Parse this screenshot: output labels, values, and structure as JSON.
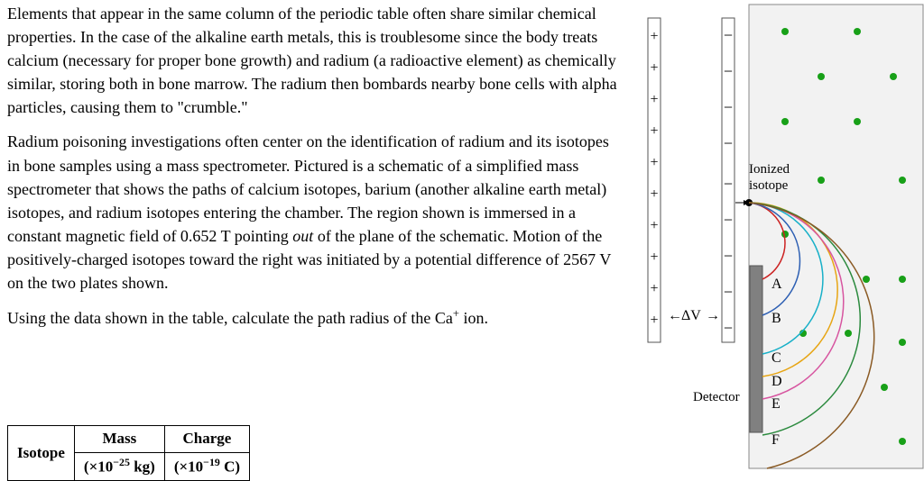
{
  "para1": "Elements that appear in the same column of the periodic table often share similar chemical properties. In the case of the alkaline earth metals, this is troublesome since the body treats calcium (necessary for proper bone growth) and radium (a radioactive element) as chemically similar, storing both in bone marrow. The radium then bombards nearby bone cells with alpha particles, causing them to \"crumble.\"",
  "para2": "Radium poisoning investigations often center on the identification of radium and its isotopes in bone samples using a mass spectrometer. Pictured is a schematic of a simplified mass spectrometer that shows the paths of calcium isotopes, barium (another alkaline earth metal) isotopes, and radium isotopes entering the chamber. The region shown is immersed in a constant magnetic field of 0.652 T pointing ",
  "para2_italic": "out",
  "para2_b": " of the plane of the schematic. Motion of the positively-charged isotopes toward the right was initiated by a potential difference of 2567 V on the two plates shown.",
  "para3_a": "Using the data shown in the table, calculate the path radius of the Ca",
  "para3_b": " ion.",
  "table": {
    "h_isotope": "Isotope",
    "h_mass": "Mass",
    "h_mass_unit_a": "(×10",
    "h_mass_unit_exp": "−25",
    "h_mass_unit_b": " kg)",
    "h_charge": "Charge",
    "h_charge_unit_a": "(×10",
    "h_charge_unit_exp": "−19",
    "h_charge_unit_b": " C)"
  },
  "diagram": {
    "ionized": "Ionized",
    "isotope": "isotope",
    "deltaV": "ΔV",
    "detector": "Detector",
    "labels": [
      "A",
      "B",
      "C",
      "D",
      "E",
      "F"
    ],
    "plus": "+",
    "minus": "−"
  },
  "chart_data": {
    "type": "diagram",
    "context": "mass-spectrometer schematic",
    "magnetic_field_T": 0.652,
    "magnetic_field_direction": "out of plane",
    "potential_difference_V": 2567,
    "plates": {
      "left": "positive",
      "right": "negative"
    },
    "paths": [
      {
        "label": "A",
        "approx_radius_rel": 0.3,
        "color": "#cc2222"
      },
      {
        "label": "B",
        "approx_radius_rel": 0.4,
        "color": "#2d5fb3"
      },
      {
        "label": "C",
        "approx_radius_rel": 0.52,
        "color": "#18b0c8"
      },
      {
        "label": "D",
        "approx_radius_rel": 0.56,
        "color": "#e7a513"
      },
      {
        "label": "E",
        "approx_radius_rel": 0.68,
        "color": "#d755a0"
      },
      {
        "label": "F",
        "approx_radius_rel": 0.78,
        "color": "#2b8a3e"
      },
      {
        "label": "(outer)",
        "approx_radius_rel": 0.95,
        "color": "#8a5a24"
      }
    ],
    "field_dots_grid": "regular green dots indicating B out of page"
  }
}
